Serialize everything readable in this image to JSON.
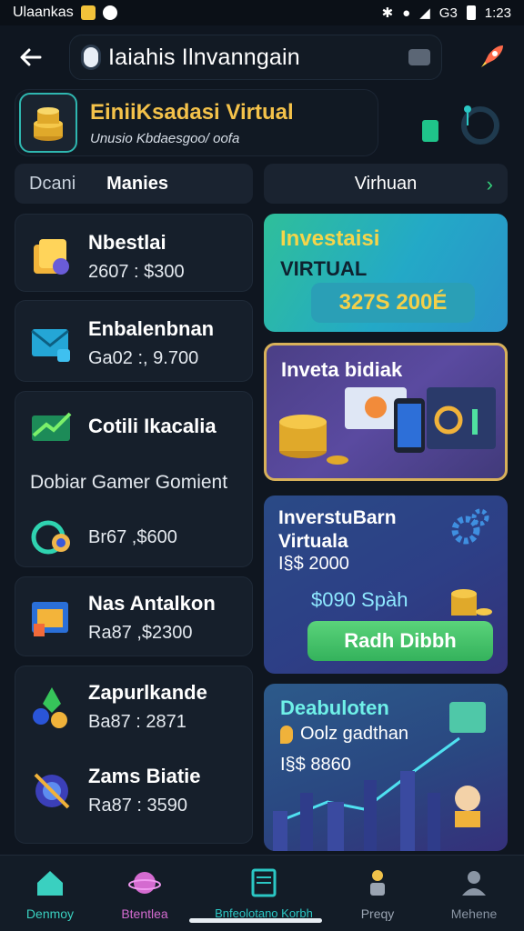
{
  "status_bar": {
    "app_name": "Ulaankas",
    "time": "1:23",
    "signal": "G3"
  },
  "app_bar": {
    "search_text": "Iaiahis Ilnvanngain"
  },
  "header": {
    "title": "EiniiKsadasi Virtual",
    "subtitle": "Unusio Kbdaesgoo/ oofa"
  },
  "tabs": {
    "left_tab": "Dcani",
    "left_tab_active": "Manies",
    "right_tab": "Virhuan"
  },
  "list_items": [
    {
      "title": "Nbestlai",
      "value": "2607 : $300",
      "icon": "coin-box-icon"
    },
    {
      "title": "Enbalenbnan",
      "value": "Ga02 :, 9.700",
      "icon": "envelope-icon"
    },
    {
      "title": "Cotili Ikacalia",
      "value": "",
      "icon": "chart-envelope-icon"
    },
    {
      "title": "Dobiar Gamer Gomient",
      "value": "Br67 ,$600",
      "icon": "ring-icon"
    },
    {
      "title": "Nas Antalkon",
      "value": "Ra87 ,$2300",
      "icon": "calendar-icon"
    },
    {
      "title": "Zapurlkande",
      "value": "Ba87 : 2871",
      "icon": "gem-icon"
    },
    {
      "title": "Zams Biatie",
      "value": "Ra87 : 3590",
      "icon": "globe-icon"
    }
  ],
  "promos": {
    "card1": {
      "title": "Investaisi",
      "subtitle": "VIRTUAL",
      "amount": "327S 200É"
    },
    "card2": {
      "title": "Inveta bidiak"
    },
    "card3": {
      "title": "InverstuBarn",
      "title2": "Virtuala",
      "value": "I§$ 2000",
      "mid": "$090 Spàh",
      "button": "Radh Dibbh"
    },
    "card4": {
      "title": "Deabuloten",
      "subtitle": "Oolz gadthan",
      "value": "I§$ 8860"
    }
  },
  "bottom_nav": [
    {
      "label": "Denmoy",
      "color": "#3ad0c0"
    },
    {
      "label": "Btentlea",
      "color": "#d46bd0"
    },
    {
      "label": "Bnfeolotano Korbh",
      "color": "#2bc7c4"
    },
    {
      "label": "Preqy",
      "color": "#9aa4b2"
    },
    {
      "label": "Mehene",
      "color": "#8a95a4"
    }
  ],
  "colors": {
    "accent_teal": "#2bc7c4",
    "accent_gold": "#f4c24a",
    "bg": "#0f1620"
  }
}
